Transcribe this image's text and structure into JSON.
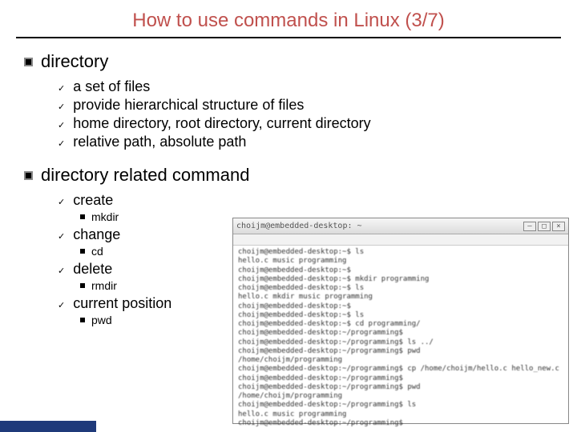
{
  "title": "How to use commands in Linux (3/7)",
  "sections": [
    {
      "heading": "directory",
      "items": [
        {
          "text": "a set of files"
        },
        {
          "text": "provide hierarchical structure of files"
        },
        {
          "text": "home directory, root directory, current directory"
        },
        {
          "text": "relative path, absolute path"
        }
      ]
    },
    {
      "heading": "directory related command",
      "items": [
        {
          "text": "create",
          "sub": "mkdir"
        },
        {
          "text": "change",
          "sub": "cd"
        },
        {
          "text": "delete",
          "sub": "rmdir"
        },
        {
          "text": "current position",
          "sub": "pwd"
        }
      ]
    }
  ],
  "terminal": {
    "title": "choijm@embedded-desktop: ~",
    "lines": [
      "choijm@embedded-desktop:~$ ls",
      "hello.c  music  programming",
      "choijm@embedded-desktop:~$",
      "choijm@embedded-desktop:~$ mkdir programming",
      "choijm@embedded-desktop:~$ ls",
      "hello.c  mkdir music  programming",
      "choijm@embedded-desktop:~$",
      "choijm@embedded-desktop:~$ ls",
      "choijm@embedded-desktop:~$ cd programming/",
      "choijm@embedded-desktop:~/programming$",
      "choijm@embedded-desktop:~/programming$ ls ../",
      "choijm@embedded-desktop:~/programming$ pwd",
      "/home/choijm/programming",
      "choijm@embedded-desktop:~/programming$ cp /home/choijm/hello.c hello_new.c",
      "choijm@embedded-desktop:~/programming$",
      "choijm@embedded-desktop:~/programming$ pwd",
      "/home/choijm/programming",
      "choijm@embedded-desktop:~/programming$ ls",
      "hello.c  music  programming",
      "choijm@embedded-desktop:~/programming$"
    ]
  }
}
